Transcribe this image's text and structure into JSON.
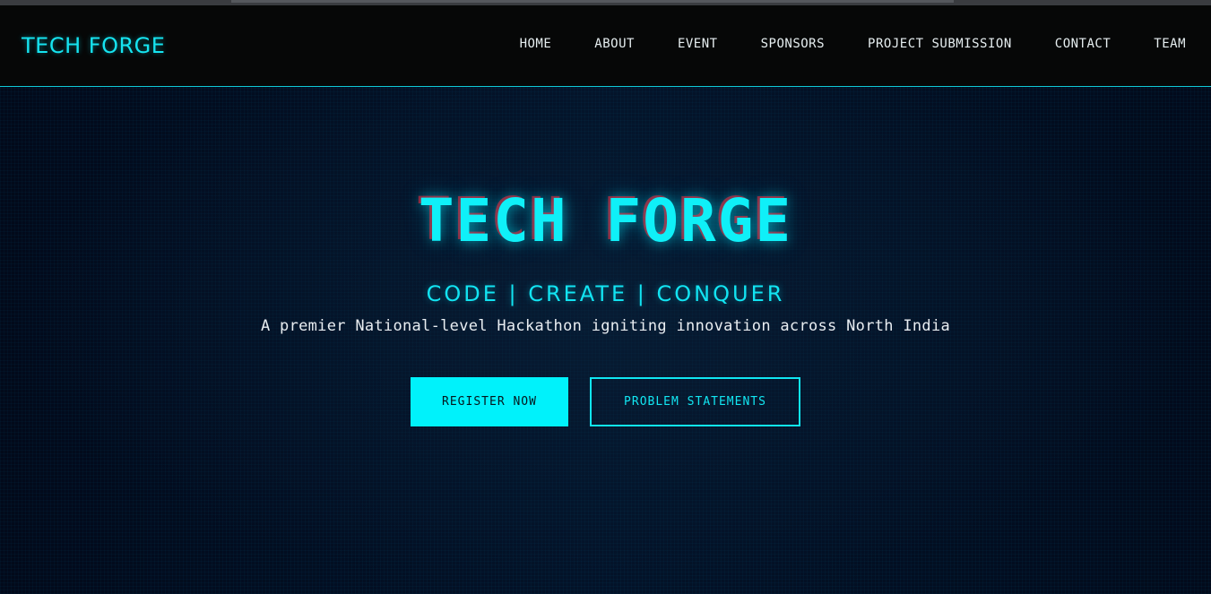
{
  "navbar": {
    "brand": "TECH FORGE",
    "links": [
      "HOME",
      "ABOUT",
      "EVENT",
      "SPONSORS",
      "PROJECT SUBMISSION",
      "CONTACT",
      "TEAM"
    ]
  },
  "hero": {
    "title": "TECH FORGE",
    "tagline": "CODE | CREATE | CONQUER",
    "subtitle": "A premier National-level Hackathon igniting innovation across North India",
    "primary_button": "REGISTER NOW",
    "secondary_button": "PROBLEM STATEMENTS"
  },
  "colors": {
    "accent": "#00f2fb",
    "background": "#031126",
    "nav_background": "#060707",
    "text": "#e6eef0"
  }
}
